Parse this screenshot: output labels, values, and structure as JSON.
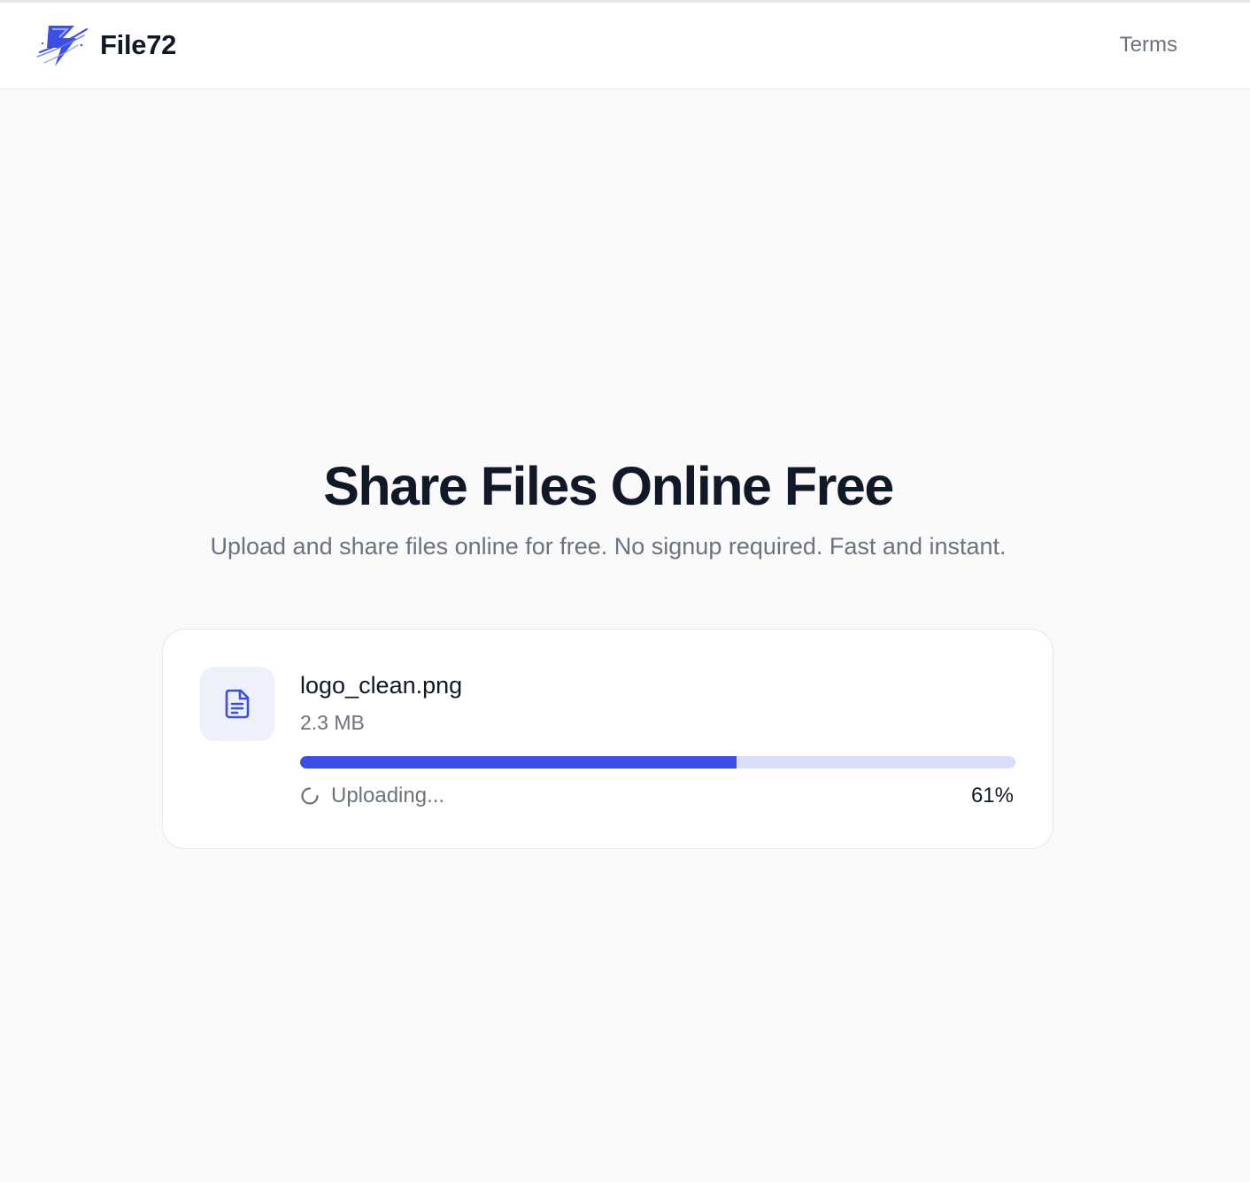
{
  "header": {
    "brand_name": "File72",
    "logo_icon": "lightning-bolt-icon",
    "nav": {
      "terms_label": "Terms"
    }
  },
  "hero": {
    "title": "Share Files Online Free",
    "subtitle": "Upload and share files online for free. No signup required. Fast and instant."
  },
  "upload": {
    "file_icon": "document-icon",
    "file_name": "logo_clean.png",
    "file_size": "2.3 MB",
    "status_icon": "spinner-icon",
    "status": "Uploading...",
    "progress_fraction": 0.61,
    "progress_label": "61%"
  },
  "colors": {
    "accent": "#3b4fe4",
    "track": "#d9ddfa",
    "icon_bg": "#eef0fc",
    "background": "#fafafa",
    "text_muted": "#6b7280"
  }
}
